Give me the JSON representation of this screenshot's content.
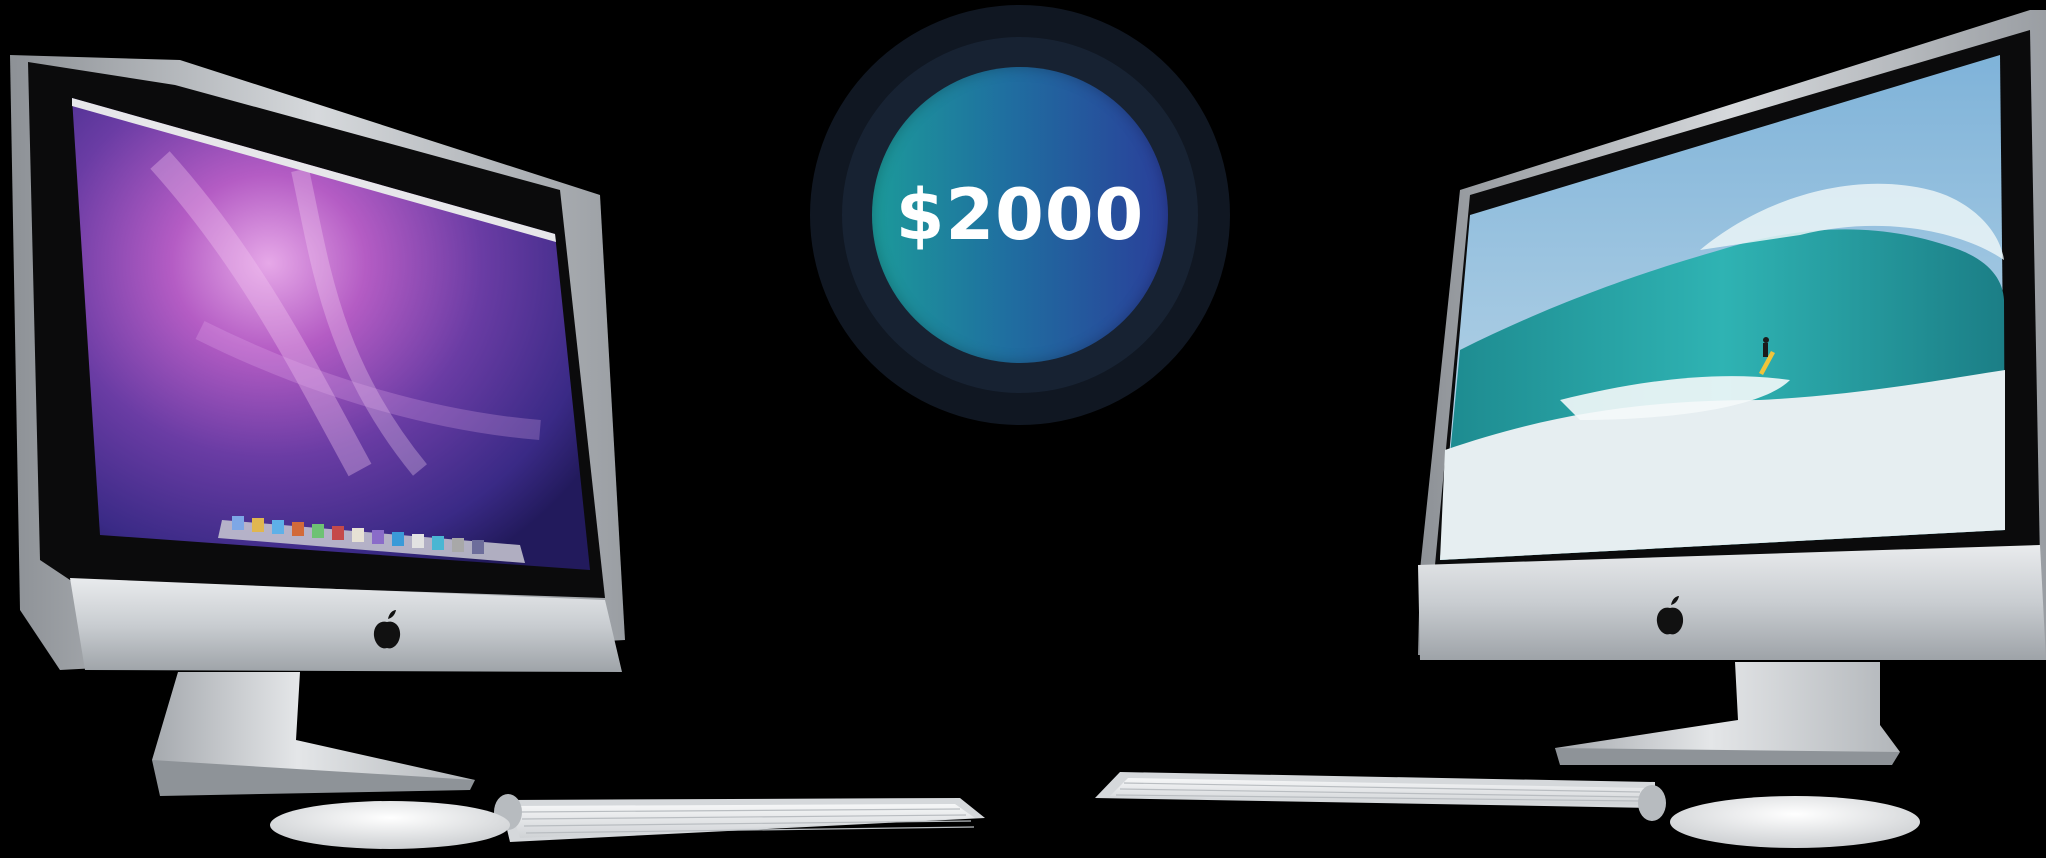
{
  "price": {
    "label": "$2000"
  },
  "colors": {
    "background": "#000000",
    "badge_outer": "#101722",
    "badge_mid": "#172232",
    "badge_gradient_start": "#1c9a9a",
    "badge_gradient_end": "#2a3f9a",
    "price_text": "#ffffff",
    "aluminum": "#c9cdd1"
  },
  "scene": {
    "left_computer": {
      "screen_wallpaper": "purple-aurora",
      "has_dock": true
    },
    "right_computer": {
      "screen_wallpaper": "ocean-wave-surfer"
    },
    "icons": [
      "apple-logo-icon",
      "apple-logo-icon"
    ]
  }
}
